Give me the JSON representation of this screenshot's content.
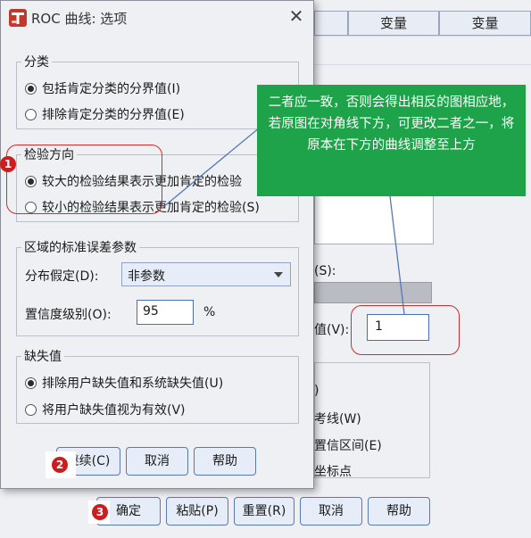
{
  "background": {
    "column_headers": [
      "变量",
      "变量"
    ],
    "label_s": "(S):",
    "label_v": "值(V):",
    "cutoff_value": "1",
    "partial_labels": [
      ")",
      "考线(W)",
      "置信区间(E)",
      "坐标点"
    ],
    "buttons": {
      "ok": "确定",
      "paste": "粘贴(P)",
      "reset": "重置(R)",
      "cancel": "取消",
      "help": "帮助"
    }
  },
  "dialog": {
    "title": "ROC 曲线: 选项",
    "classification": {
      "title": "分类",
      "options": [
        "包括肯定分类的分界值(I)",
        "排除肯定分类的分界值(E)"
      ],
      "selected": 0
    },
    "test_direction": {
      "title": "检验方向",
      "options": [
        "较大的检验结果表示更加肯定的检验",
        "较小的检验结果表示更加肯定的检验(S)"
      ],
      "selected": 0
    },
    "se_params": {
      "title": "区域的标准误差参数",
      "distribution_label": "分布假定(D):",
      "distribution_value": "非参数",
      "confidence_label": "置信度级别(O):",
      "confidence_value": "95",
      "percent": "%"
    },
    "missing": {
      "title": "缺失值",
      "options": [
        "排除用户缺失值和系统缺失值(U)",
        "将用户缺失值视为有效(V)"
      ],
      "selected": 0
    },
    "buttons": {
      "continue": "继续(C)",
      "cancel": "取消",
      "help": "帮助"
    }
  },
  "annotation": {
    "text": "二者应一致，否则会得出相反的图相应地，若原图在对角线下方，可更改二者之一，将原本在下方的曲线调整至上方",
    "badges": [
      "1",
      "2",
      "3"
    ],
    "colors": {
      "green": "#1fa34a",
      "red": "#d42b2b"
    }
  }
}
